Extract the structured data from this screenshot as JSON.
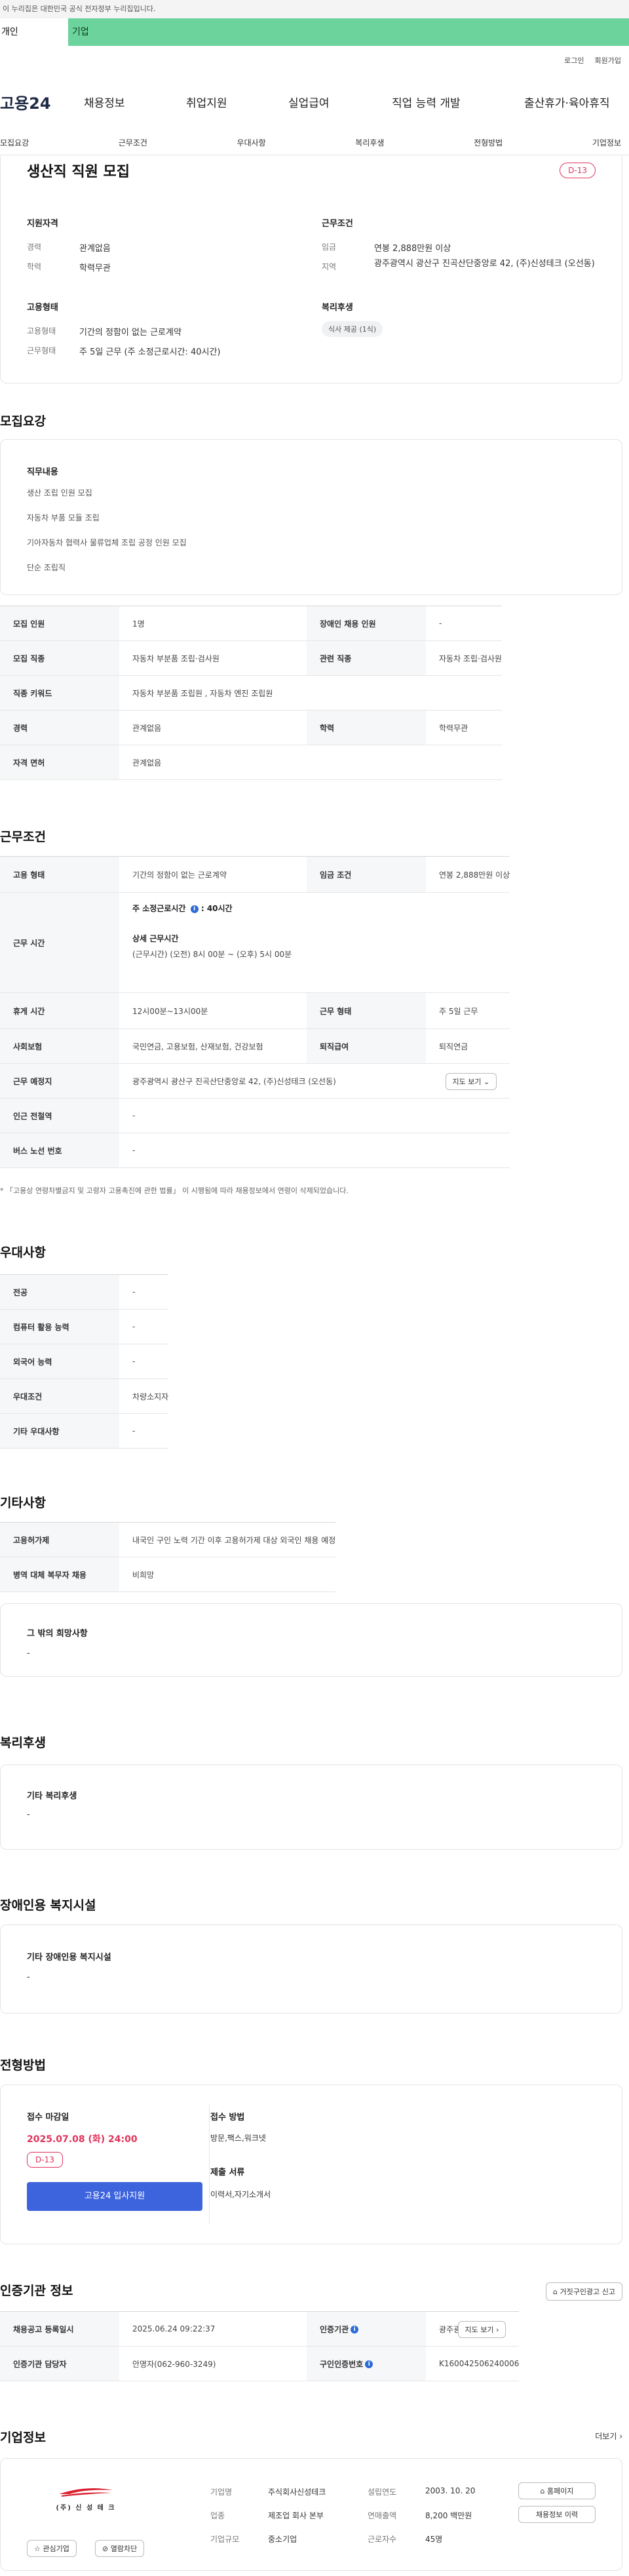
{
  "gov_banner": "이 누리집은 대한민국 공식 전자정부 누리집입니다.",
  "user_tabs": {
    "personal": "개인",
    "business": "기업"
  },
  "top_links": {
    "login": "로그인",
    "signup": "회원가입"
  },
  "logo": "고용24",
  "gnb": [
    "채용정보",
    "취업지원",
    "실업급여",
    "직업 능력 개발",
    "출산휴가·육아휴직"
  ],
  "sub_nav": [
    "모집요강",
    "근무조건",
    "우대사항",
    "복리후생",
    "전형방법",
    "기업정보"
  ],
  "summary": {
    "title": "생산직 직원 모집",
    "dday": "D-13",
    "qual_title": "지원자격",
    "career_label": "경력",
    "career": "관계없음",
    "edu_label": "학력",
    "edu": "학력무관",
    "cond_title": "근무조건",
    "wage_label": "임금",
    "wage": "연봉 2,888만원 이상",
    "region_label": "지역",
    "region": "광주광역시 광산구 진곡산단중앙로 42, (주)신성테크 (오선동)",
    "emp_title": "고용형태",
    "emptype_label": "고용형태",
    "emptype": "기간의 정함이 없는 근로계약",
    "worktype_label": "근무형태",
    "worktype": "주 5일 근무 (주 소정근로시간: 40시간)",
    "welfare_title": "복리후생",
    "welfare_chip": "식사 제공 (1식)"
  },
  "recruit": {
    "section_title": "모집요강",
    "duty_title": "직무내용",
    "duties": [
      "생산 조립 인원 모집",
      "자동차 부품 모듈 조립",
      "기아자동차 협력사 물류업체 조립 공정 인원 모집",
      "단순 조립직"
    ],
    "rows": {
      "headcount_label": "모집 인원",
      "headcount": "1명",
      "disabled_label": "장애인 채용 인원",
      "disabled": "-",
      "job_label": "모집 직종",
      "job": "자동차 부분품 조립·검사원",
      "related_label": "관련 직종",
      "related": "자동차 조립·검사원",
      "keyword_label": "직종 키워드",
      "keyword": "자동차 부분품 조립원 , 자동차 엔진 조립원",
      "career_label": "경력",
      "career": "관계없음",
      "edu_label": "학력",
      "edu": "학력무관",
      "license_label": "자격 면허",
      "license": "관계없음"
    }
  },
  "conditions": {
    "section_title": "근무조건",
    "emp_label": "고용 형태",
    "emp": "기간의 정함이 없는 근로계약",
    "wage_label": "임금 조건",
    "wage": "연봉 2,888만원 이상",
    "time_label": "근무 시간",
    "time_weekly": "주 소정근로시간",
    "time_weekly_val": ": 40시간",
    "time_detail_title": "상세 근무시간",
    "time_detail": "(근무시간) (오전) 8시 00분 ~ (오후) 5시 00분",
    "break_label": "휴게 시간",
    "break": "12시00분~13시00분",
    "worktype_label": "근무 형태",
    "worktype": "주 5일 근무",
    "insurance_label": "사회보험",
    "insurance": "국민연금, 고용보험, 산재보험, 건강보험",
    "retire_label": "퇴직급여",
    "retire": "퇴직연금",
    "place_label": "근무 예정지",
    "place": "광주광역시 광산구 진곡산단중앙로 42, (주)신성테크 (오선동)",
    "map_btn": "지도 보기",
    "subway_label": "인근 전철역",
    "subway": "-",
    "bus_label": "버스 노선 번호",
    "bus": "-",
    "note": "* 「고용상 연령차별금지 및 고령자 고용촉진에 관한 법률」 이 시행됨에 따라 채용정보에서 연령이 삭제되었습니다."
  },
  "prefer": {
    "section_title": "우대사항",
    "major_label": "전공",
    "major": "-",
    "computer_label": "컴퓨터 활용 능력",
    "computer": "-",
    "lang_label": "외국어 능력",
    "lang": "-",
    "cond_label": "우대조건",
    "cond": "차량소지자",
    "etc_label": "기타 우대사항",
    "etc": "-"
  },
  "other": {
    "section_title": "기타사항",
    "foreign_label": "고용허가제",
    "foreign": "내국인 구인 노력 기간 이후 고용허가제 대상 외국인 채용 예정",
    "military_label": "병역 대체 복무자 채용",
    "military": "비희망",
    "extra_title": "그 밖의 희망사항",
    "extra": "-"
  },
  "welfare": {
    "section_title": "복리후생",
    "box_title": "기타 복리후생",
    "box_val": "-"
  },
  "disabled_fac": {
    "section_title": "장애인용 복지시설",
    "box_title": "기타 장애인용 복지시설",
    "box_val": "-"
  },
  "selection": {
    "section_title": "전형방법",
    "deadline_title": "접수 마감일",
    "deadline": "2025.07.08 (화) 24:00",
    "dday": "D-13",
    "apply_btn": "고용24 입사지원",
    "method_title": "접수 방법",
    "method": "방문,팩스,워크넷",
    "docs_title": "제출 서류",
    "docs": "이력서,자기소개서"
  },
  "cert": {
    "section_title": "인증기관 정보",
    "report_btn": "거짓구인광고 신고",
    "reg_label": "채용공고 등록일시",
    "reg": "2025.06.24 09:22:37",
    "org_label": "인증기관",
    "org": "광주광산고용센터",
    "map_btn": "지도 보기",
    "manager_label": "인증기관 담당자",
    "manager": "안명자(062-960-3249)",
    "no_label": "구인인증번호",
    "no": "K160042506240006"
  },
  "company": {
    "section_title": "기업정보",
    "more": "더보기",
    "logo_text": "(주) 신 성 테 크",
    "name_label": "기업명",
    "name": "주식회사신성테크",
    "year_label": "설립연도",
    "year": "2003. 10. 20",
    "industry_label": "업종",
    "industry": "제조업 회사 본부",
    "sales_label": "연매출액",
    "sales": "8,200 백만원",
    "size_label": "기업규모",
    "size": "중소기업",
    "staff_label": "근로자수",
    "staff": "45명",
    "home_btn": "홈페이지",
    "history_btn": "채용정보 이력",
    "fav_btn": "관심기업",
    "block_btn": "열람차단"
  },
  "colors": {
    "brand_green": "#6bd39b",
    "primary_blue": "#3d63dd",
    "dday_red": "#e0335a"
  }
}
